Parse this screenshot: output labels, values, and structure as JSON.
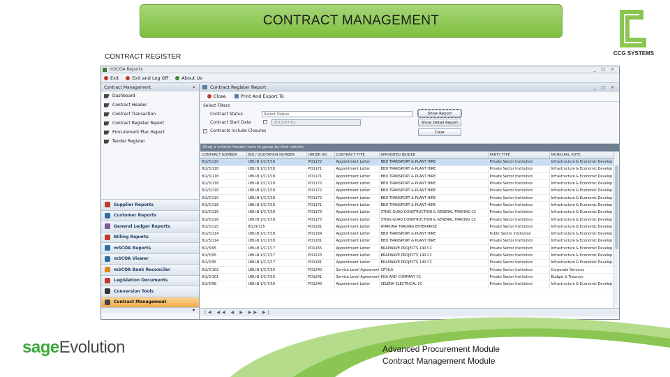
{
  "slide": {
    "title": "CONTRACT MANAGEMENT",
    "subtitle": "CONTRACT REGISTER",
    "logo_text": "CCG SYSTEMS",
    "brand_bold": "sage",
    "brand_regular": "Evolution",
    "module_line1": "Advanced Procurement Module",
    "module_line2": "Contract Management Module"
  },
  "app": {
    "title": "mSCOA Reports",
    "window_controls": "_ □ ×",
    "toolbar": [
      {
        "label": "Exit",
        "color": "#c0392b"
      },
      {
        "label": "Exit and Log Off",
        "color": "#c0392b"
      },
      {
        "label": "About Us",
        "color": "#3a8a2e"
      }
    ]
  },
  "sidebar": {
    "header": "Contract Management",
    "collapse_glyph": "«",
    "links": [
      "Dashboard",
      "Contract Header",
      "Contract Transaction",
      "Contract Register Report",
      "Procurement Plan Report",
      "Tender Register"
    ],
    "modules": [
      {
        "label": "Supplier Reports",
        "color": "#c0392b"
      },
      {
        "label": "Customer Reports",
        "color": "#2e6da4"
      },
      {
        "label": "General Ledger Reports",
        "color": "#7a5a9c"
      },
      {
        "label": "Billing Reports",
        "color": "#c0392b"
      },
      {
        "label": "mSCOA Reports",
        "color": "#2e6da4"
      },
      {
        "label": "mSCOA Viewer",
        "color": "#2e6da4"
      },
      {
        "label": "mSCOA Bank Reconciler",
        "color": "#e08a1e"
      },
      {
        "label": "Legislation Documents",
        "color": "#c0392b"
      },
      {
        "label": "Conversion Tools",
        "color": "#333333"
      },
      {
        "label": "Contract Management",
        "color": "#444444",
        "active": true
      }
    ],
    "bottom_glyph": "▾"
  },
  "report": {
    "title": "Contract Register Report",
    "window_controls": "_ □ ×",
    "toolbar": [
      "Close",
      "Print And Export To"
    ],
    "filters_group": "Select Filters",
    "contract_status_label": "Contract Status",
    "contract_status_value": "Select Status",
    "start_date_label": "Contract Start Date",
    "start_date_value": "2013/07/01",
    "include_closed_label": "Contracts Include Closures",
    "show_report_btn": "Show Report",
    "show_detail_btn": "Show Detail Report",
    "clear_btn": "Clear",
    "group_hint": "Drag a column header here to group by that column",
    "nav_glyphs": "|◀ ◀◀ ◀ ▶ ▶▶ ▶|",
    "columns": [
      "CONTRACT NUMBER",
      "BID / QUOTATION NUMBER",
      "ORDER NO",
      "CONTRACT TYPE",
      "APPOINTED BIDDER",
      "PARTY TYPE",
      "MUNICIPAL VOTE"
    ],
    "rows": [
      [
        "8/2/3/110",
        "UBU-B 1/C/7/18",
        "PO1172",
        "Appointment Letter",
        "BBD TRANSPORT & PLANT HIRE",
        "Private Sector Institution",
        "Infrastructure & Economic Develop"
      ],
      [
        "8/2/3/118",
        "UBU B 1/C/7/18",
        "PO1171",
        "Appointment Letter",
        "BBD TRANSPORT & PLANT HIRE",
        "Private Sector Institution",
        "Infrastructure & Economic Develop"
      ],
      [
        "8/2/3/118",
        "UBU-B 1/C/7/18",
        "PO1171",
        "Appointment Letter",
        "BBD TRANSPORT & PLANT HIRE",
        "Private Sector Institution",
        "Infrastructure & Economic Develop"
      ],
      [
        "8/2/3/118",
        "UBU-B 1/C/7/18",
        "PO1172",
        "Appointment Letter",
        "BBD TRANSPORT & PLANT HIRE",
        "Private Sector Institution",
        "Infrastructure & Economic Develop"
      ],
      [
        "8/2/3/118",
        "UBU-B 1/C/7/18",
        "PO1172",
        "Appointment Letter",
        "BBD TRANSPORT & PLANT HIRE",
        "Private Sector Institution",
        "Infrastructure & Economic Develop"
      ],
      [
        "8/2/3/110",
        "UBU-B 1/C/7/18",
        "PO1172",
        "Appointment Letter",
        "BBD TRANSPORT & PLANT HIRE",
        "Private Sector Institution",
        "Infrastructure & Economic Develop"
      ],
      [
        "8/2/3/118",
        "UBU-B 1/C/7/18",
        "PO1171",
        "Appointment Letter",
        "BBD TRANSPORT & PLANT HIRE",
        "Private Sector Institution",
        "Infrastructure & Economic Develop"
      ],
      [
        "8/2/3/116",
        "UBU-B 1/C/7/18",
        "PO1173",
        "Appointment Letter",
        "STING GUAQ CONSTRUCTION & GENERAL TRADING CC",
        "Private Sector Institution",
        "Infrastructure & Economic Develop"
      ],
      [
        "8/2/3/116",
        "UBU-B 1/C/7/18",
        "PO1173",
        "Appointment Letter",
        "STING GUAQ CONSTRUCTION & GENERAL TRADING CC",
        "Private Sector Institution",
        "Infrastructure & Economic Develop"
      ],
      [
        "8/2/3/115",
        "8/2/3/115",
        "PO1181",
        "Appointment Letter",
        "AYAKUMA TRADING ENTERPRISE",
        "Private Sector Institution",
        "Infrastructure & Economic Develop"
      ],
      [
        "8/2/3/114",
        "UBU-B 1/C/7/18",
        "PO1164",
        "Appointment Letter",
        "BBD TRANSPORT & PLANT HIRE",
        "Public Sector Institution",
        "Infrastructure & Economic Develop"
      ],
      [
        "8/2/3/114",
        "UBU-B 1/C/7/18",
        "PO1181",
        "Appointment Letter",
        "BBD TRANSPORT & PLANT HIRE",
        "Private Sector Institution",
        "Infrastructure & Economic Develop"
      ],
      [
        "8/2/3/95",
        "UBU-B 1/C/7/17",
        "PO1165",
        "Appointment Letter",
        "BRAPWAVE PROJECTS 140 CC",
        "Private Sector Institution",
        "Infrastructure & Economic Develop"
      ],
      [
        "8/2/3/95",
        "UBU-B 1/C/7/17",
        "PO1223",
        "Appointment Letter",
        "BRAPWAVE PROJECTS 140 CC",
        "Private Sector Institution",
        "Infrastructure & Economic Develop"
      ],
      [
        "8/2/3/95",
        "UBU-B 1/C/7/17",
        "PO1181",
        "Appointment Letter",
        "BRAPWAVE PROJECTS 140 CC",
        "Private Sector Institution",
        "Infrastructure & Economic Develop"
      ],
      [
        "8/2/3/102",
        "UBU-B 1/C/7/16",
        "PO1240",
        "Service Level Agreement",
        "SITHLA",
        "Private Sector Institution",
        "Corporate Services"
      ],
      [
        "8/2/3/101",
        "UBU-B 1/C/7/16",
        "PO1241",
        "Service Level Agreement",
        "KGA AND COMPANY CC",
        "Private Sector Institution",
        "Budget & Treasury"
      ],
      [
        "8/2/3/98",
        "UBU-B 1/C/7/16",
        "PO1240",
        "Appointment Letter",
        "SELENA ELECTRICAL CC",
        "Private Sector Institution",
        "Infrastructure & Economic Develop"
      ]
    ]
  },
  "colors": {
    "title_green": "#8cc652",
    "brand_green": "#3aa83a",
    "active_module": "#f1a94a",
    "selected_row": "#c9ddf3"
  }
}
